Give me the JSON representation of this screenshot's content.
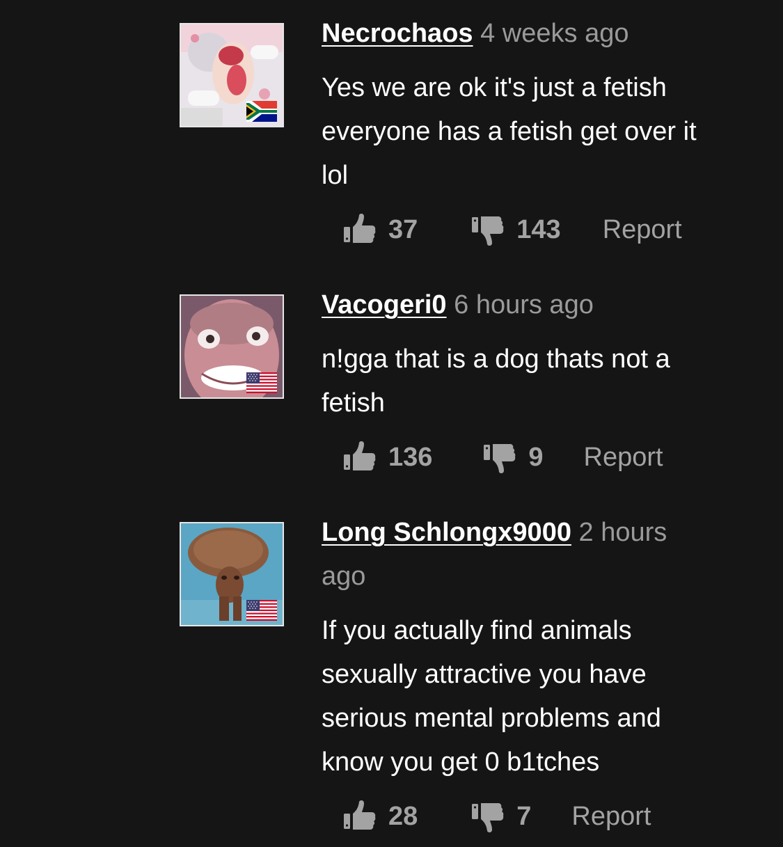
{
  "comments": [
    {
      "username": "Necrochaos",
      "time": "4 weeks ago",
      "text_lines": [
        "Yes we are ok it's just a fetish",
        "everyone has a fetish get over it",
        "lol"
      ],
      "likes": "37",
      "dislikes": "143",
      "report_label": "Report",
      "flag": "south-africa-flag-icon"
    },
    {
      "username": "Vacogeri0",
      "time": "6 hours ago",
      "text_lines": [
        "n!gga that is a dog thats not a",
        "fetish"
      ],
      "likes": "136",
      "dislikes": "9",
      "report_label": "Report",
      "flag": "us-flag-icon"
    },
    {
      "username": "Long Schlongx9000",
      "time_line1": "2 hours",
      "time_line2": "ago",
      "text_lines": [
        "If you actually find animals",
        "sexually attractive you have",
        "serious mental problems and",
        "know you get 0 b1tches"
      ],
      "likes": "28",
      "dislikes": "7",
      "report_label": "Report",
      "flag": "us-flag-icon"
    }
  ],
  "colors": {
    "background": "#151515",
    "username": "#ffffff",
    "time": "#9a9a9a",
    "actions": "#a3a3a3"
  }
}
